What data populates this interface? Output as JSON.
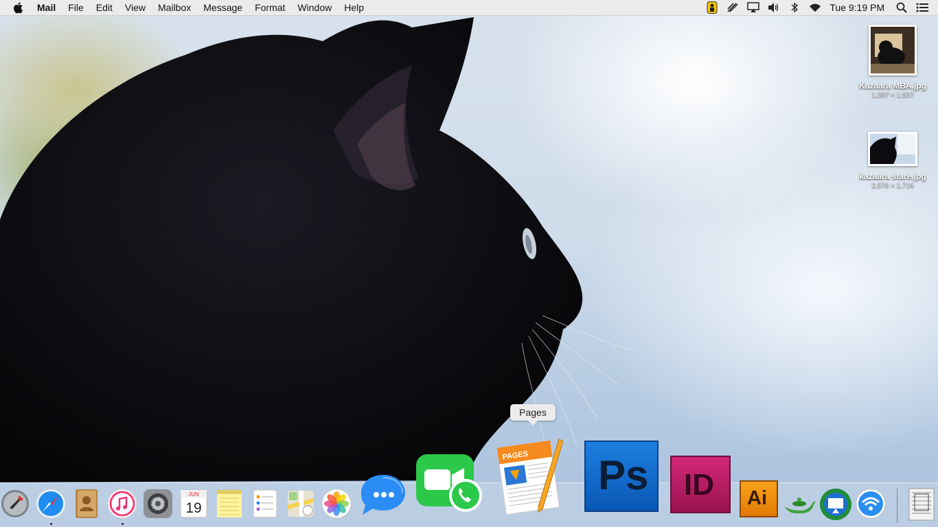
{
  "menubar": {
    "app_name": "Mail",
    "items": [
      "File",
      "Edit",
      "View",
      "Mailbox",
      "Message",
      "Format",
      "Window",
      "Help"
    ],
    "clock": "Tue 9:19 PM",
    "status_icons": [
      "user-lock-icon",
      "audio-hijack-icon",
      "airplay-icon",
      "volume-icon",
      "bluetooth-icon",
      "wifi-icon",
      "spotlight-search-icon",
      "notification-center-icon"
    ]
  },
  "desktop_files": [
    {
      "name": "Kazaara MBA.jpg",
      "dims": "1,397 × 1,537"
    },
    {
      "name": "kazaara stare.jpg",
      "dims": "2,576 × 1,716"
    }
  ],
  "dock": {
    "tooltip": "Pages",
    "app_labels": {
      "photoshop": "Ps",
      "indesign": "ID",
      "illustrator": "Ai",
      "pages_label": "PAGES",
      "calendar_month": "JUN",
      "calendar_day": "19"
    },
    "apps": [
      "Launchpad",
      "Safari",
      "Contacts",
      "iTunes",
      "System Preferences",
      "Calendar",
      "Notes",
      "Reminders",
      "Maps",
      "Photos",
      "Messages",
      "FaceTime",
      "Pages",
      "Photoshop",
      "InDesign",
      "Illustrator",
      "Genie",
      "Screen Mirroring",
      "Wireless Diagnostics",
      "Downloads"
    ]
  },
  "colors": {
    "photoshop": "#0a6ccf",
    "indesign": "#c41e6b",
    "illustrator": "#f29312",
    "facetime": "#2cc84a",
    "messages": "#2b8cf5"
  }
}
